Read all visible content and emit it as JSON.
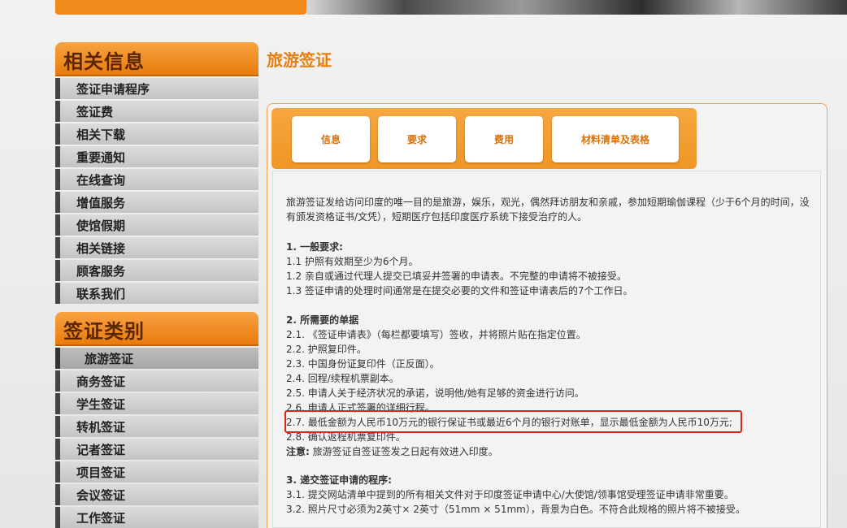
{
  "sidebar": {
    "related_title": "相关信息",
    "related_items": [
      {
        "label": "签证申请程序"
      },
      {
        "label": "签证费"
      },
      {
        "label": "相关下载"
      },
      {
        "label": "重要通知"
      },
      {
        "label": "在线查询"
      },
      {
        "label": "增值服务"
      },
      {
        "label": "使馆假期"
      },
      {
        "label": "相关链接"
      },
      {
        "label": "顾客服务"
      },
      {
        "label": "联系我们"
      }
    ],
    "types_title": "签证类别",
    "type_items": [
      {
        "label": "旅游签证",
        "active": true
      },
      {
        "label": "商务签证"
      },
      {
        "label": "学生签证"
      },
      {
        "label": "转机签证"
      },
      {
        "label": "记者签证"
      },
      {
        "label": "项目签证"
      },
      {
        "label": "会议签证"
      },
      {
        "label": "工作签证"
      }
    ]
  },
  "main": {
    "title": "旅游签证",
    "tabs": [
      {
        "label": "信息"
      },
      {
        "label": "要求"
      },
      {
        "label": "费用"
      },
      {
        "label": "材料清单及表格"
      }
    ],
    "intro": "旅游签证发给访问印度的唯一目的是旅游，娱乐，观光，偶然拜访朋友和亲戚，参加短期瑜伽课程（少于6个月的时间，没有颁发资格证书/文凭），短期医疗包括印度医疗系统下接受治疗的人。",
    "section1": {
      "heading": "1. 一般要求:",
      "lines": [
        "1.1 护照有效期至少为6个月。",
        "1.2 亲自或通过代理人提交已填妥并签署的申请表。不完整的申请将不被接受。",
        "1.3 签证申请的处理时间通常是在提交必要的文件和签证申请表后的7个工作日。"
      ]
    },
    "section2": {
      "heading": "2. 所需要的单据",
      "lines": [
        "2.1. 《签证申请表》（每栏都要填写）签收，并将照片贴在指定位置。",
        "2.2. 护照复印件。",
        "2.3. 中国身份证复印件（正反面）。",
        "2.4. 回程/续程机票副本。",
        "2.5. 申请人关于经济状况的承诺，说明他/她有足够的资金进行访问。",
        "2.6. 申请人正式签署的详细行程。",
        "2.7. 最低金额为人民币10万元的银行保证书或最近6个月的银行对账单，显示最低金额为人民币10万元;",
        "2.8. 确认返程机票复印件。"
      ],
      "note_label": "注意:",
      "note_text": " 旅游签证自签证签发之日起有效进入印度。"
    },
    "section3": {
      "heading": "3. 递交签证申请的程序:",
      "lines": [
        "3.1. 提交网站清单中提到的所有相关文件对于印度签证申请中心/大使馆/领事馆受理签证申请非常重要。",
        "3.2. 照片尺寸必须为2英寸× 2英寸（51mm × 51mm），背景为白色。不符合此规格的照片将不被接受。"
      ]
    }
  },
  "colors": {
    "accent": "#e67e12",
    "highlight": "#d8261e"
  }
}
